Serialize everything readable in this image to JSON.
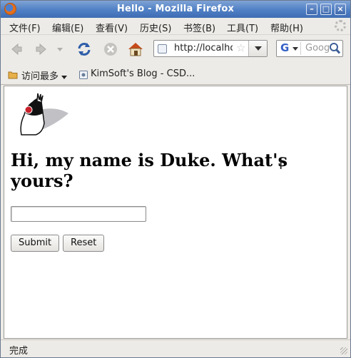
{
  "window": {
    "title": "Hello - Mozilla Firefox",
    "controls": [
      "minimize-icon",
      "maximize-icon",
      "close-icon"
    ]
  },
  "menu": {
    "items": [
      "文件(F)",
      "编辑(E)",
      "查看(V)",
      "历史(S)",
      "书签(B)",
      "工具(T)",
      "帮助(H)"
    ]
  },
  "toolbar": {
    "icons": [
      "back-icon",
      "forward-icon",
      "history-dropdown-icon",
      "reload-icon",
      "stop-icon",
      "home-icon"
    ],
    "url": "http://localhost",
    "search_placeholder": "Google",
    "search_engine": "G"
  },
  "bookmarks": {
    "items": [
      "访问最多",
      "KimSoft's Blog - CSD..."
    ]
  },
  "page": {
    "heading": "Hi, my name is Duke. What's yours?",
    "input_value": "",
    "submit_label": "Submit",
    "reset_label": "Reset"
  },
  "status": {
    "text": "完成"
  },
  "colors": {
    "title_bar": "#4f7fc4",
    "chrome": "#edebe7",
    "content_bg": "#ffffff",
    "duke_nose": "#c8202a"
  }
}
